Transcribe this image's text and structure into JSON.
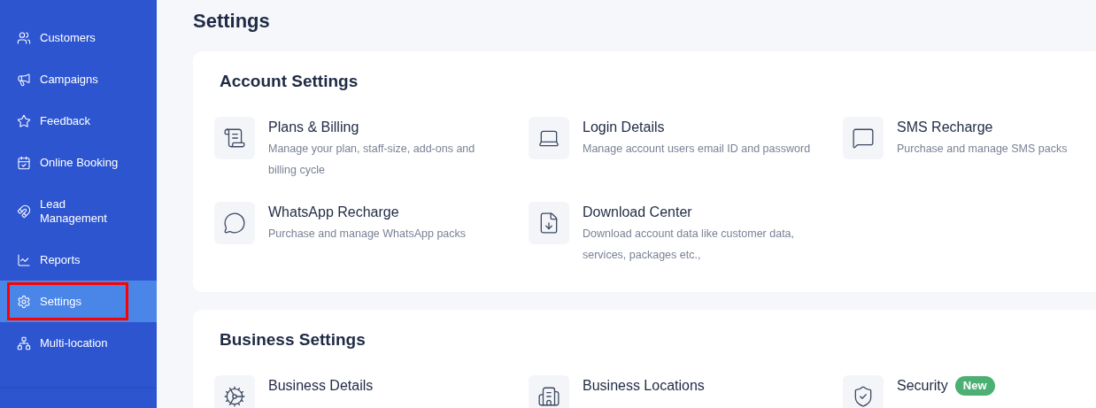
{
  "sidebar": {
    "items": [
      {
        "label": "Customers",
        "selected": false,
        "highlighted": false
      },
      {
        "label": "Campaigns",
        "selected": false,
        "highlighted": false
      },
      {
        "label": "Feedback",
        "selected": false,
        "highlighted": false
      },
      {
        "label": "Online Booking",
        "selected": false,
        "highlighted": false
      },
      {
        "label": "Lead Management",
        "selected": false,
        "highlighted": false
      },
      {
        "label": "Reports",
        "selected": false,
        "highlighted": false
      },
      {
        "label": "Settings",
        "selected": true,
        "highlighted": true
      },
      {
        "label": "Multi-location",
        "selected": false,
        "highlighted": false
      }
    ]
  },
  "page_title": "Settings",
  "sections": [
    {
      "title": "Account Settings",
      "items": [
        {
          "title": "Plans & Billing",
          "description": "Manage your plan, staff-size, add-ons and billing cycle"
        },
        {
          "title": "Login Details",
          "description": "Manage account users email ID and password"
        },
        {
          "title": "SMS Recharge",
          "description": "Purchase and manage SMS packs"
        },
        {
          "title": "WhatsApp Recharge",
          "description": "Purchase and manage WhatsApp packs"
        },
        {
          "title": "Download Center",
          "description": "Download account data like customer data, services, packages etc.,"
        }
      ]
    },
    {
      "title": "Business Settings",
      "items": [
        {
          "title": "Business Details"
        },
        {
          "title": "Business Locations"
        },
        {
          "title": "Security",
          "badge": "New"
        }
      ]
    }
  ]
}
